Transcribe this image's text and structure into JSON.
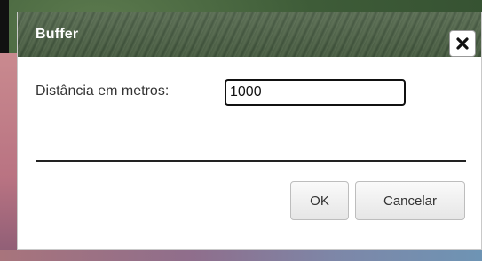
{
  "dialog": {
    "title": "Buffer",
    "close_icon": "close-icon",
    "field": {
      "label": "Distância em metros:",
      "value": "1000"
    },
    "buttons": {
      "ok": "OK",
      "cancel": "Cancelar"
    }
  },
  "colors": {
    "titlebar": "#4b6045",
    "title_text": "#ffffff",
    "dialog_bg": "#ffffff"
  }
}
